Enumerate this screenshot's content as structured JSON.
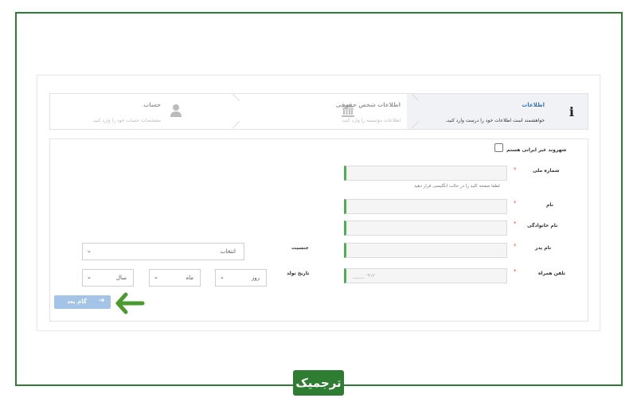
{
  "stepper": {
    "info": {
      "title": "اطلاعات",
      "subtitle": "خواهشمند است اطلاعات خود را درست وارد کنید."
    },
    "legal": {
      "title": "اطلاعات شخص حقوقی",
      "subtitle": "اطلاعات مؤسسه را وارد کنید."
    },
    "account": {
      "title": "حساب",
      "subtitle": "مشخصات حساب خود را وارد کنید."
    }
  },
  "form": {
    "citizen_checkbox_label": "شهروند غیر ایرانی هستم",
    "national_id_label": "شماره ملی",
    "national_id_hint": "لطفا صفحه کلید را در حالت انگلیسی قرار دهید",
    "first_name_label": "نام",
    "last_name_label": "نام خانوادگی",
    "father_name_label": "نام پدر",
    "gender_label": "جنسیت",
    "gender_select_value": "انتخاب",
    "mobile_label": "تلفن همراه",
    "mobile_placeholder": "۰۹۱۲_____",
    "birth_date_label": "تاریخ تولد",
    "day_value": "روز",
    "month_value": "ماه",
    "year_value": "سال",
    "required_mark": "*"
  },
  "buttons": {
    "next_label": "گام بعد",
    "next_arrow": "➔"
  },
  "brand": {
    "logo_text": "ترجمیک"
  },
  "colors": {
    "frame": "#2e7d32",
    "accent_green": "#4caf50",
    "step_title_active": "#3a78b5",
    "button": "#a3c4e6",
    "required": "#e74c3c"
  },
  "icons": {
    "info": "info-icon",
    "legal": "bank-icon",
    "account": "user-icon",
    "arrow": "arrow-left-icon"
  }
}
